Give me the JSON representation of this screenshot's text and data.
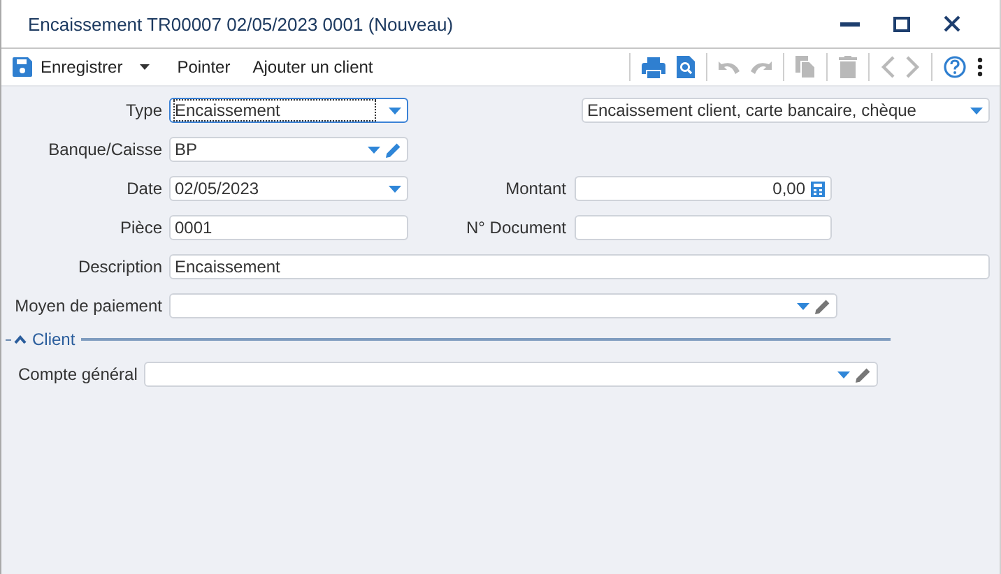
{
  "window": {
    "title": "Encaissement TR00007 02/05/2023 0001 (Nouveau)"
  },
  "toolbar": {
    "save": {
      "label": "Enregistrer"
    },
    "actions": [
      {
        "label": "Pointer"
      },
      {
        "label": "Ajouter un client"
      }
    ],
    "icons": [
      {
        "kind": "print",
        "disabled": false
      },
      {
        "kind": "preview",
        "disabled": false
      },
      {
        "kind": "undo",
        "disabled": true
      },
      {
        "kind": "redo",
        "disabled": true
      },
      {
        "kind": "copy",
        "disabled": true
      },
      {
        "kind": "delete",
        "disabled": true
      },
      {
        "kind": "previous",
        "disabled": true
      },
      {
        "kind": "next",
        "disabled": true
      },
      {
        "kind": "help",
        "disabled": false
      },
      {
        "kind": "more",
        "disabled": false
      }
    ]
  },
  "form": {
    "type": {
      "label": "Type",
      "value": "Encaissement",
      "focused": true
    },
    "type_detail": {
      "value": "Encaissement client, carte bancaire, chèque",
      "focused": false
    },
    "bank": {
      "label": "Banque/Caisse",
      "value": "BP",
      "edit_enabled": true
    },
    "date": {
      "label": "Date",
      "value": "02/05/2023"
    },
    "amount": {
      "label": "Montant",
      "value": "0,00"
    },
    "piece": {
      "label": "Pièce",
      "value": "0001"
    },
    "document_number": {
      "label": "N° Document"
    },
    "description": {
      "label": "Description",
      "value": "Encaissement"
    },
    "payment_method": {
      "label": "Moyen de paiement",
      "edit_enabled": false
    }
  },
  "client_section": {
    "title": "Client",
    "expanded": true,
    "account": {
      "label": "Compte général",
      "edit_enabled": false
    }
  }
}
